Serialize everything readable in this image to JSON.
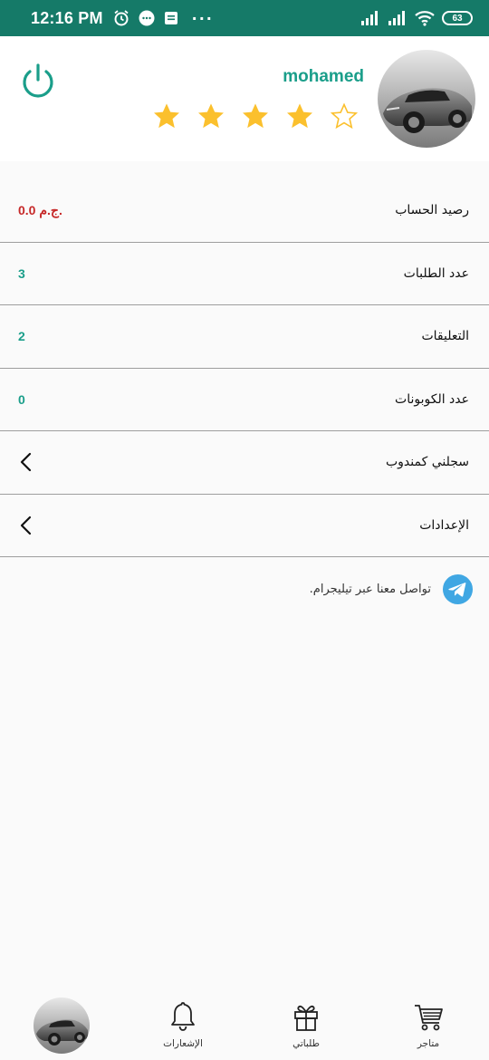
{
  "status_bar": {
    "time": "12:16 PM",
    "dots": "···",
    "battery": "63",
    "icons": [
      "alarm-icon",
      "chat-bubble-icon",
      "notification-icon",
      "signal-icon",
      "signal-icon",
      "wifi-icon",
      "battery-icon"
    ]
  },
  "profile": {
    "name": "mohamed",
    "rating": 4,
    "rating_max": 5,
    "avatar_icon": "car-avatar",
    "power_icon": "power-icon"
  },
  "rows": [
    {
      "label": "رصيد الحساب",
      "value": "0.0 ج.م.",
      "value_color": "#c62828"
    },
    {
      "label": "عدد الطلبات",
      "value": "3",
      "value_color": "#1a9e8a"
    },
    {
      "label": "التعليقات",
      "value": "2",
      "value_color": "#1a9e8a"
    },
    {
      "label": "عدد الكوبونات",
      "value": "0",
      "value_color": "#1a9e8a"
    },
    {
      "label": "سجلني كمندوب",
      "icon": "chevron-left-icon"
    },
    {
      "label": "الإعدادات",
      "icon": "chevron-left-icon"
    }
  ],
  "telegram": {
    "text": "تواصل معنا عبر تيليجرام.",
    "icon": "telegram-icon"
  },
  "nav": {
    "stores": "متاجر",
    "orders": "طلباتي",
    "notifications": "الإشعارات"
  },
  "colors": {
    "status_bar": "#157a68",
    "accent": "#1a9e8a",
    "star": "#fbc02d",
    "balance": "#c62828",
    "telegram": "#40a7e3"
  }
}
